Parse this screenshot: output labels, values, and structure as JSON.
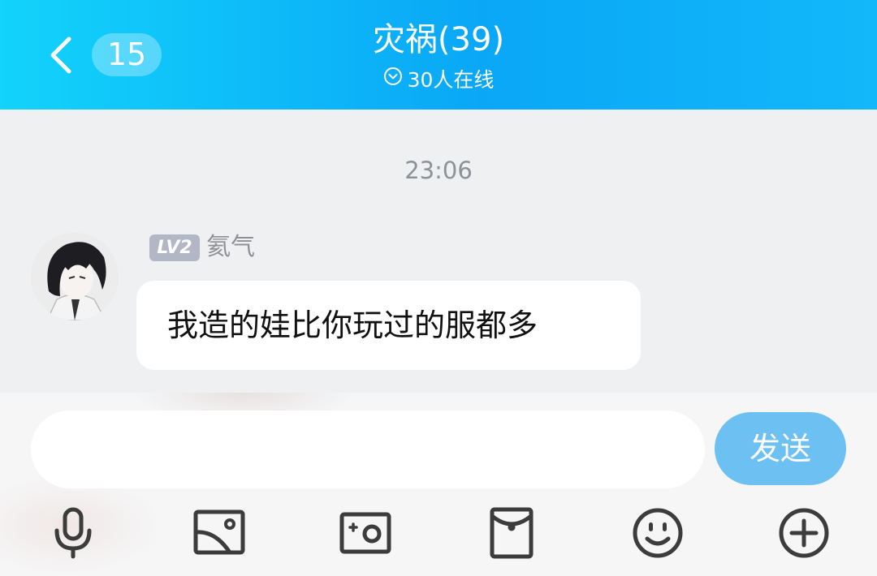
{
  "header": {
    "back_icon": "chevron-left-icon",
    "unread_count": "15",
    "title": "灾祸(39)",
    "online_status": "30人在线",
    "status_icon": "chevron-down-circle-icon"
  },
  "chat": {
    "timestamp": "23:06",
    "messages": [
      {
        "sender_level": "LV2",
        "sender_name": "氦气",
        "text": "我造的娃比你玩过的服都多"
      }
    ]
  },
  "composer": {
    "input_value": "",
    "input_placeholder": "",
    "send_label": "发送"
  },
  "toolbar": {
    "tools": [
      "microphone-icon",
      "image-icon",
      "camera-icon",
      "red-envelope-icon",
      "emoji-icon",
      "plus-icon"
    ]
  },
  "colors": {
    "header_gradient_start": "#12d3fb",
    "header_gradient_mid": "#0aa7f6",
    "send_button": "#6cc0f2",
    "level_badge": "#b3b6c4",
    "chat_background": "#eff0f1"
  }
}
